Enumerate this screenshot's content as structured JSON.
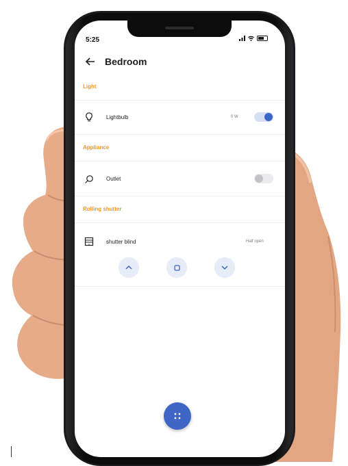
{
  "status_bar": {
    "time": "5:25"
  },
  "header": {
    "title": "Bedroom"
  },
  "sections": [
    {
      "label": "Light",
      "items": [
        {
          "name": "Lightbulb",
          "meta": "0 W",
          "on": true
        }
      ]
    },
    {
      "label": "Appliance",
      "items": [
        {
          "name": "Outlet",
          "meta": "",
          "on": false
        }
      ]
    },
    {
      "label": "Rolling shutter",
      "items": [
        {
          "name": "shutter blind",
          "meta": "Half open"
        }
      ]
    }
  ],
  "colors": {
    "accent": "#3f66c4",
    "section": "#f0962a",
    "control_bg": "#e6ecf8"
  },
  "icons": {
    "back": "arrow-left-icon",
    "light": "lightbulb-icon",
    "outlet": "plug-icon",
    "shutter": "shutter-icon",
    "fab": "grid-dots-icon"
  }
}
